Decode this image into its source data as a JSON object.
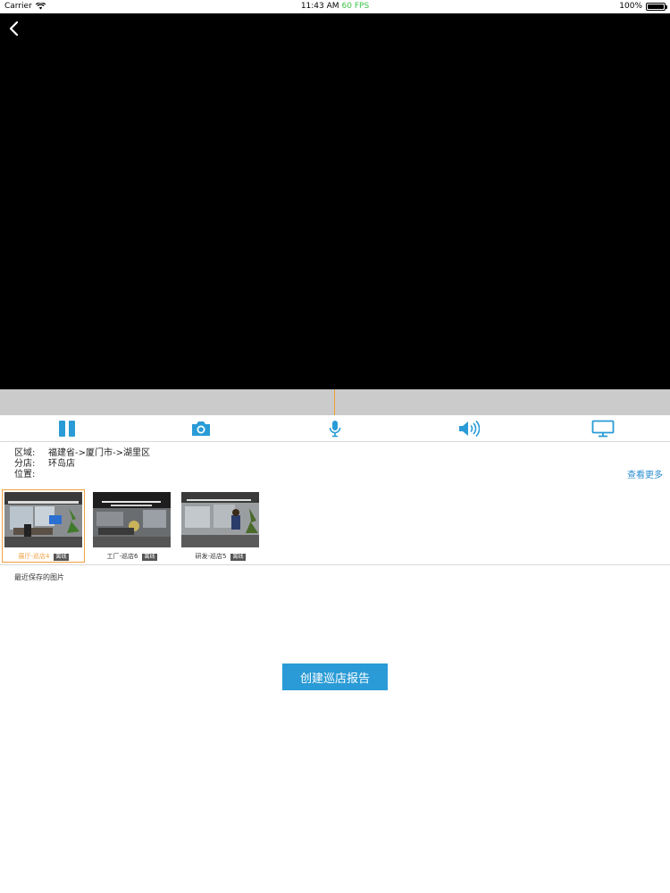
{
  "status_bar": {
    "carrier": "Carrier",
    "time": "11:43 AM",
    "fps": "60 FPS",
    "battery": "100%"
  },
  "controls": {
    "accent_color": "#2a9bd6",
    "items": [
      "pause-icon",
      "camera-icon",
      "microphone-icon",
      "speaker-icon",
      "monitor-icon"
    ]
  },
  "info": {
    "region_key": "区域:",
    "region_value": "福建省->厦门市->湖里区",
    "store_key": "分店:",
    "store_value": "环岛店",
    "location_key": "位置:",
    "location_value": ""
  },
  "see_more": "查看更多",
  "cameras": [
    {
      "name": "展厅-巡店4",
      "status": "离线",
      "selected": true
    },
    {
      "name": "工厂-巡店6",
      "status": "离线",
      "selected": false
    },
    {
      "name": "研发-巡店5",
      "status": "离线",
      "selected": false
    }
  ],
  "recent_label": "最近保存的图片",
  "create_button": "创建巡店报告"
}
